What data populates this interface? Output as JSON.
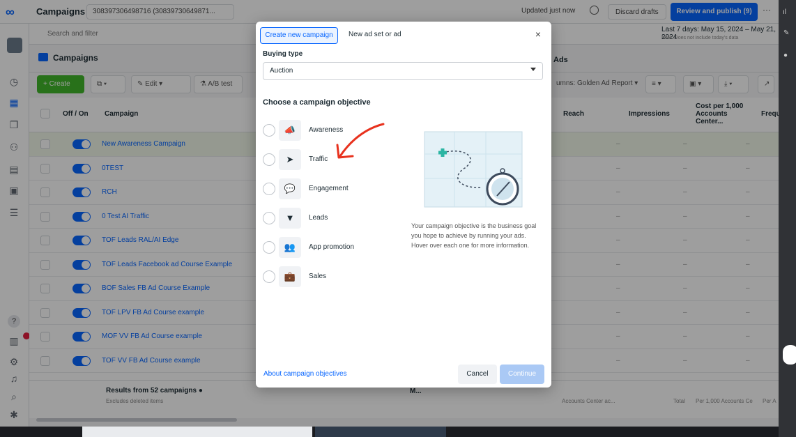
{
  "topbar": {
    "title": "Campaigns",
    "account": "308397306498716 (30839730649871...",
    "updated": "Updated just now",
    "discard": "Discard drafts",
    "review": "Review and publish (9)",
    "more": "···"
  },
  "searchbar": {
    "placeholder": "Search and filter",
    "date_range": "Last 7 days: May 15, 2024 – May 21, 2024",
    "date_note": "Note: Does not include today's data"
  },
  "tabs": {
    "campaigns": "Campaigns",
    "ads": "Ads"
  },
  "toolbar": {
    "create": "+ Create",
    "edit": "Edit",
    "ab_test": "A/B test",
    "columns": "umns: Golden Ad Report"
  },
  "table": {
    "headers": {
      "offon": "Off / On",
      "campaign": "Campaign",
      "reach": "Reach",
      "impressions": "Impressions",
      "cost": "Cost per 1,000 Accounts Center...",
      "freq": "Frequ"
    },
    "rows": [
      {
        "name": "New Awareness Campaign"
      },
      {
        "name": "0TEST"
      },
      {
        "name": "RCH"
      },
      {
        "name": "0 Test AI Traffic"
      },
      {
        "name": "TOF Leads RAL/AI Edge"
      },
      {
        "name": "TOF Leads Facebook ad Course Example"
      },
      {
        "name": "BOF Sales FB Ad Course Example"
      },
      {
        "name": "TOF LPV FB Ad Course example"
      },
      {
        "name": "MOF VV FB Ad Course example"
      },
      {
        "name": "TOF VV FB Ad Course example"
      }
    ],
    "dash": "–"
  },
  "footer": {
    "title": "Results from 52 campaigns",
    "subtitle": "Excludes deleted items",
    "mid": "M...",
    "reach_note": "Accounts Center ac...",
    "total": "Total",
    "per1000": "Per 1,000 Accounts Ce",
    "per_a": "Per A"
  },
  "modal": {
    "tab_active": "Create new campaign",
    "tab_other": "New ad set or ad",
    "close": "×",
    "buying_label": "Buying type",
    "buying_value": "Auction",
    "heading": "Choose a campaign objective",
    "objectives": [
      {
        "label": "Awareness",
        "icon": "megaphone-icon",
        "glyph": "📣"
      },
      {
        "label": "Traffic",
        "icon": "cursor-icon",
        "glyph": "➤"
      },
      {
        "label": "Engagement",
        "icon": "chat-icon",
        "glyph": "💬"
      },
      {
        "label": "Leads",
        "icon": "funnel-icon",
        "glyph": "▼"
      },
      {
        "label": "App promotion",
        "icon": "people-icon",
        "glyph": "👥"
      },
      {
        "label": "Sales",
        "icon": "briefcase-icon",
        "glyph": "💼"
      }
    ],
    "description": "Your campaign objective is the business goal you hope to achieve by running your ads. Hover over each one for more information.",
    "about": "About campaign objectives",
    "cancel": "Cancel",
    "continue": "Continue"
  },
  "colors": {
    "accent": "#0866ff",
    "create": "#42b72a",
    "annotation": "#e8321e"
  }
}
